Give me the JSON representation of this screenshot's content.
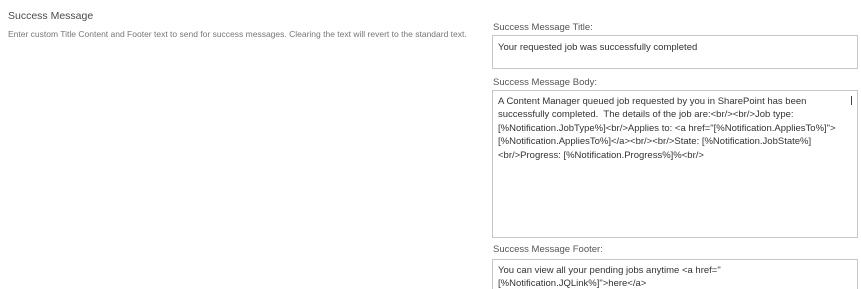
{
  "section": {
    "title": "Success Message",
    "description": "Enter custom Title Content and Footer text to send for success messages. Clearing the text will revert to the standard text."
  },
  "fields": {
    "title": {
      "label": "Success Message Title:",
      "value": "Your requested job was successfully completed"
    },
    "body": {
      "label": "Success Message Body:",
      "value": "A Content Manager queued job requested by you in SharePoint has been successfully completed.  The details of the job are:<br/><br/>Job type: [%Notification.JobType%]<br/>Applies to: <a href=\"[%Notification.AppliesTo%]\">[%Notification.AppliesTo%]</a><br/><br/>State: [%Notification.JobState%]<br/>Progress: [%Notification.Progress%]%<br/>"
    },
    "footer": {
      "label": "Success Message Footer:",
      "value": "You can view all your pending jobs anytime <a href=\"[%Notification.JQLink%]\">here</a>"
    }
  }
}
